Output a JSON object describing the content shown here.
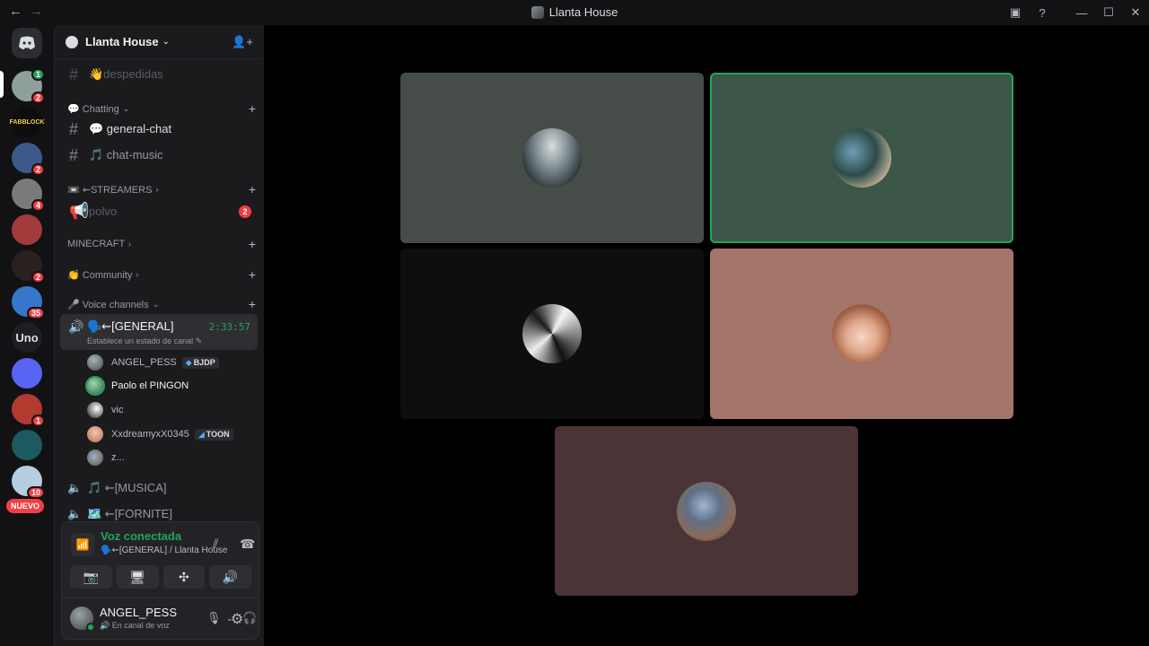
{
  "titlebar": {
    "back": "←",
    "forward": "→",
    "title": "Llanta House",
    "inbox": "▣",
    "help": "?",
    "minimize": "—",
    "maximize": "☐",
    "close": "✕"
  },
  "guilds": {
    "home_icon": "discord-logo-icon",
    "items": [
      {
        "name": "server-1",
        "badge": "2",
        "badge_top": "1",
        "color": "#8fa09a"
      },
      {
        "name": "fabblock",
        "label": "FABBLOCK",
        "color": "#0d0d0d"
      },
      {
        "name": "server-3",
        "badge": "2",
        "color": "#3b5a8a"
      },
      {
        "name": "server-4",
        "badge": "4",
        "color": "#7a7a7a"
      },
      {
        "name": "server-5",
        "color": "#a33b3b"
      },
      {
        "name": "server-6",
        "badge": "2",
        "color": "#2a2020"
      },
      {
        "name": "server-7",
        "badge": "35",
        "color": "#3577c9"
      },
      {
        "name": "uno",
        "label": "Uno",
        "color": "#1e1f22"
      },
      {
        "name": "server-9",
        "color": "#5865f2"
      },
      {
        "name": "server-10",
        "badge": "1",
        "color": "#b23a2f"
      },
      {
        "name": "server-11",
        "color": "#1d5a5f"
      },
      {
        "name": "server-12",
        "badge": "10",
        "color": "#b7cde0"
      }
    ],
    "new_label": "NUEVO"
  },
  "server": {
    "name": "Llanta House",
    "channels_top": [
      {
        "name": "👋despedidas"
      }
    ],
    "categories": {
      "chatting": "💬 Chatting",
      "streamers": "📼 ⇜STREAMERS",
      "minecraft": "MINECRAFT",
      "community": "👏 Community",
      "voice": "🎤 Voice channels"
    },
    "chatting_channels": [
      {
        "name": "💬 general-chat"
      },
      {
        "name": "🎵 chat-music"
      }
    ],
    "streamers_channel": {
      "name": "polvo",
      "unread": "2"
    },
    "voice_channel": {
      "name": "🗣️⇜[GENERAL]",
      "timer": "2:33:57",
      "status_hint": "Establece un estado de canal ✎"
    },
    "voice_users": [
      {
        "name": "ANGEL_PESS",
        "tag": "BJDP",
        "color": "#8a9398"
      },
      {
        "name": "Paolo el PINGON",
        "color": "#2f6b45"
      },
      {
        "name": "vic",
        "color": "#e0e0e0"
      },
      {
        "name": "XxdreamyxX0345",
        "tag": "TOON",
        "color": "#c98b72"
      },
      {
        "name": "z...",
        "color": "#5a7aa0"
      }
    ],
    "other_voice": [
      {
        "name": "🎵 ⇜[MUSICA]"
      },
      {
        "name": "🗺️ ⇜[FORNITE]"
      }
    ]
  },
  "voice_panel": {
    "title": "Voz conectada",
    "subtitle": "🗣️⇜[GENERAL] / Llanta House",
    "buttons": {
      "camera": "📷",
      "screenshare": "🖥",
      "activities": "✣",
      "soundboard": "🔊"
    }
  },
  "user": {
    "name": "ANGEL_PESS",
    "status": "En canal de voz",
    "mic": "🎙",
    "headphones": "🎧",
    "settings": "⚙"
  },
  "stage": {
    "tiles": [
      {
        "name": "tile-angel",
        "bg": "#464c47"
      },
      {
        "name": "tile-paolo",
        "bg": "#3c5648",
        "speaking": true
      },
      {
        "name": "tile-vic",
        "bg": "#0e0e0e"
      },
      {
        "name": "tile-dreamy",
        "bg": "#a4756a"
      },
      {
        "name": "tile-z",
        "bg": "#4b3435"
      }
    ]
  }
}
